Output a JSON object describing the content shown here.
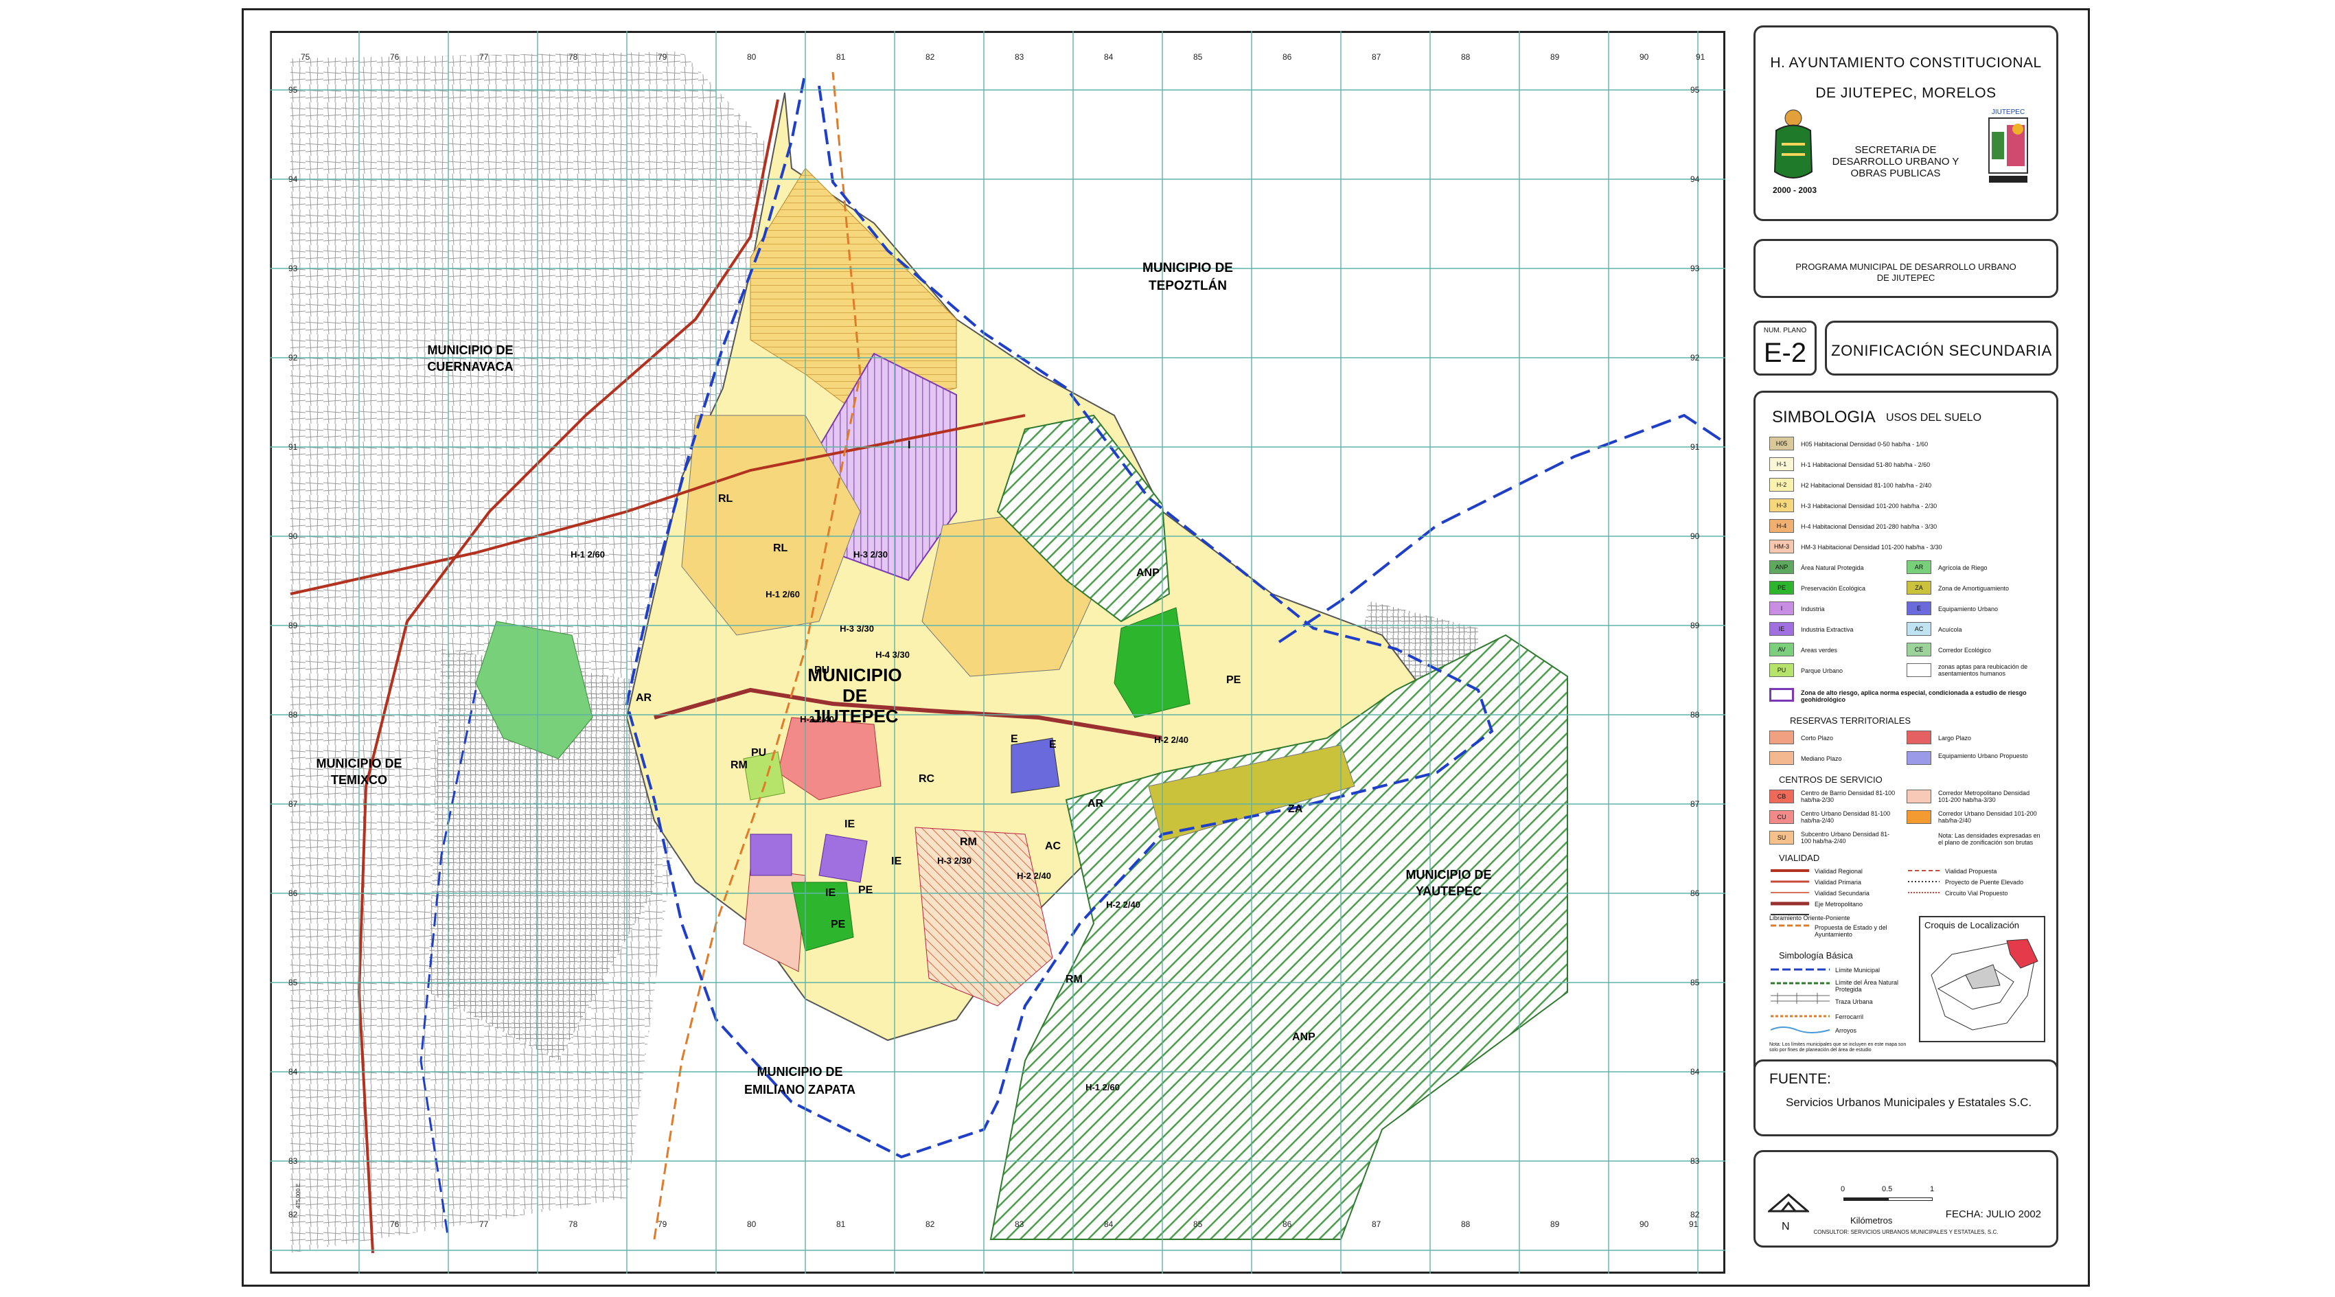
{
  "header": {
    "title_line1": "H. AYUNTAMIENTO CONSTITUCIONAL",
    "title_line2": "DE JIUTEPEC, MORELOS",
    "secretaria": "SECRETARIA DE DESARROLLO URBANO Y OBRAS PUBLICAS",
    "period": "2000 - 2003"
  },
  "program": {
    "line1": "PROGRAMA MUNICIPAL DE DESARROLLO URBANO",
    "line2": "DE JIUTEPEC"
  },
  "plan": {
    "num_label": "NUM. PLANO",
    "code": "E-2",
    "title": "ZONIFICACIÓN SECUNDARIA"
  },
  "legend": {
    "heading": "SIMBOLOGIA",
    "subheading": "USOS DEL SUELO",
    "land_uses": [
      {
        "code": "H05",
        "label": "H05 Habitacional Densidad 0-50 hab/ha - 1/60",
        "color": "#d9c89a"
      },
      {
        "code": "H-1",
        "label": "H-1 Habitacional Densidad 51-80 hab/ha - 2/60",
        "color": "#fbf7d6"
      },
      {
        "code": "H-2",
        "label": "H2 Habitacional Densidad 81-100 hab/ha - 2/40",
        "color": "#fbf2b0"
      },
      {
        "code": "H-3",
        "label": "H-3 Habitacional Densidad 101-200 hab/ha - 2/30",
        "color": "#f6d77c"
      },
      {
        "code": "H-4",
        "label": "H-4 Habitacional Densidad 201-280 hab/ha - 3/30",
        "color": "#f2b070"
      },
      {
        "code": "HM-3",
        "label": "HM-3 Habitacional Densidad 101-200 hab/ha - 3/30",
        "color": "#f7c7b0"
      }
    ],
    "categories_left": [
      {
        "code": "ANP",
        "label": "Área Natural Protegida",
        "color": "#5fa85f"
      },
      {
        "code": "PE",
        "label": "Preservación Ecológica",
        "color": "#2db52d"
      },
      {
        "code": "I",
        "label": "Industria",
        "color": "#c78ee3"
      },
      {
        "code": "IE",
        "label": "Industria Extractiva",
        "color": "#a070e0"
      },
      {
        "code": "AV",
        "label": "Areas verdes",
        "color": "#7ccf7c"
      },
      {
        "code": "PU",
        "label": "Parque Urbano",
        "color": "#b6e36a"
      }
    ],
    "categories_right": [
      {
        "code": "AR",
        "label": "Agrícola de Riego",
        "color": "#78d07a"
      },
      {
        "code": "ZA",
        "label": "Zona de Amortiguamiento",
        "color": "#c9c23a"
      },
      {
        "code": "E",
        "label": "Equipamiento Urbano",
        "color": "#6a6adc"
      },
      {
        "code": "AC",
        "label": "Acuícola",
        "color": "#bfe3f0"
      },
      {
        "code": "CE",
        "label": "Corredor Ecológico",
        "color": "#9bd39b"
      },
      {
        "code": "ZR",
        "label": "zonas aptas para reubicación de asentamientos humanos",
        "color": "#ffffff"
      }
    ],
    "riesgo": "Zona de alto riesgo, aplica norma especial, condicionada a estudio de riesgo geohidrológico",
    "reservas_head": "RESERVAS TERRITORIALES",
    "reservas": [
      {
        "label": "Corto Plazo",
        "color": "#f1a082"
      },
      {
        "label": "Largo Plazo",
        "color": "#e56060"
      },
      {
        "label": "Mediano Plazo",
        "color": "#f3b890"
      },
      {
        "label": "Equipamiento Urbano Propuesto",
        "color": "#9a9ae8"
      }
    ],
    "centros_head": "CENTROS DE SERVICIO",
    "centros": [
      {
        "code": "CB",
        "label": "Centro de Barrio Densidad 81-100 hab/ha-2/30",
        "color": "#f06a5a"
      },
      {
        "code": "CU",
        "label": "Centro Urbano Densidad 81-100 hab/ha-2/40",
        "color": "#f28a8a"
      },
      {
        "code": "SU",
        "label": "Subcentro Urbano Densidad 81-100 hab/ha-2/40",
        "color": "#f5c08a"
      },
      {
        "code": "CM",
        "label": "Corredor Metropolitano Densidad 101-200 hab/ha-3/30",
        "color": "#f7c9b6"
      },
      {
        "code": "CUR",
        "label": "Corredor Urbano Densidad 101-200 hab/ha-2/40",
        "color": "#f39a30"
      }
    ],
    "nota_densidades": "Nota: Las densidades expresadas en el plano de zonificación son brutas",
    "vialidad_head": "VIALIDAD",
    "vialidad": [
      "Vialidad Regional",
      "Vialidad Primaria",
      "Vialidad Secundaria",
      "Eje Metropolitano",
      "Libramiento Oriente-Poniente",
      "Propuesta de Estado y del Ayuntamiento",
      "Vialidad Propuesta",
      "Proyecto de Puente Elevado",
      "Circuito Vial Propuesto"
    ],
    "basica_head": "Simbología Básica",
    "basica": [
      "Límite Municipal",
      "Límite del Área Natural Protegida",
      "Traza Urbana",
      "Ferrocarril",
      "Arroyos"
    ],
    "nota_limites": "Nota: Los límites municipales que se incluyen en este mapa son solo por fines de planeación del área de estudio",
    "croquis_head": "Croquis de Localización"
  },
  "fuente": {
    "head": "FUENTE:",
    "text": "Servicios Urbanos Municipales y Estatales S.C."
  },
  "footer": {
    "north": "N",
    "scale_label": "Kilómetros",
    "scale_ticks": [
      "0",
      "0.5",
      "1"
    ],
    "fecha": "FECHA: JULIO 2002",
    "consultor": "CONSULTOR: SERVICIOS URBANOS MUNICIPALES Y ESTATALES, S.C."
  },
  "map": {
    "x_ticks": [
      "75",
      "76",
      "77",
      "78",
      "79",
      "80",
      "81",
      "82",
      "83",
      "84",
      "85",
      "86",
      "87",
      "88",
      "89",
      "90",
      "91"
    ],
    "y_ticks": [
      "95",
      "94",
      "93",
      "92",
      "91",
      "90",
      "89",
      "88",
      "87",
      "86",
      "85",
      "84",
      "83",
      "82"
    ],
    "corner_label": "475,000 E",
    "municipios": [
      {
        "name": "MUNICIPIO DE TEPOZTLÁN"
      },
      {
        "name": "MUNICIPIO DE CUERNAVACA"
      },
      {
        "name": "MUNICIPIO DE JIUTEPEC"
      },
      {
        "name": "MUNICIPIO DE TEMIXCO"
      },
      {
        "name": "MUNICIPIO DE YAUTEPEC"
      },
      {
        "name": "MUNICIPIO DE EMILIANO ZAPATA"
      }
    ],
    "zones": [
      "ANP",
      "ANP",
      "AR",
      "AR",
      "PE",
      "PE",
      "PE",
      "PU",
      "PU",
      "RM",
      "RM",
      "RM",
      "RL",
      "RL",
      "RC",
      "IE",
      "IE",
      "IE",
      "E",
      "E",
      "AC",
      "ZA",
      "I",
      "H-1 2/60",
      "H-2 2/40",
      "H-3 2/30",
      "H-1 2/60",
      "H-2 2/40",
      "H-3 3/30",
      "H-4 3/30",
      "H-2 2/40",
      "H-1 2/60",
      "H-2 2/40",
      "H-3 2/30"
    ]
  },
  "colors": {
    "frame": "#222222",
    "grid": "#5fb3a8",
    "anp": "#4e9d4e",
    "h2": "#fbf2b0",
    "h3": "#f6d77c",
    "industria": "#c78ee3",
    "limite": "#1f3fc8",
    "vial_regional": "#b2321f"
  }
}
